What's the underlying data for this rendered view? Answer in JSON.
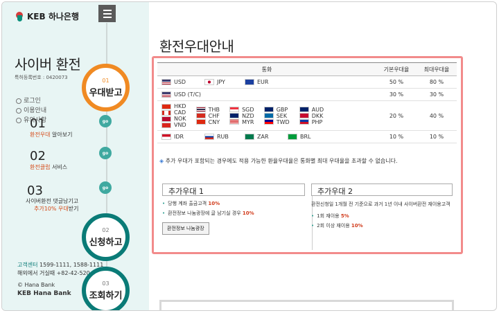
{
  "sidebar": {
    "logo": "KEB 하나은행",
    "title": "사이버 환전",
    "reg_no": "특허등록번호 : 0420073",
    "links": [
      "로그인",
      "이용안내",
      "유의사항"
    ],
    "step1": {
      "num": "01",
      "label": "우대받고"
    },
    "sub1": {
      "n": "01",
      "hl": "환전우대",
      "rest": " 알아보기"
    },
    "sub2": {
      "n": "02",
      "hl": "환전클럽",
      "rest": " 서비스"
    },
    "sub3": {
      "n": "03",
      "line1": "사이버환전 댓글남기고",
      "hl": "추가10% 우대",
      "rest": "받기"
    },
    "go": "go",
    "step2": {
      "num": "02",
      "label": "신청하고"
    },
    "step3": {
      "num": "03",
      "label": "조회하기"
    },
    "contact": {
      "label": "고객센터",
      "phones": " 1599-1111, 1588-1111",
      "overseas": "해외에서 거실때 +82-42-520"
    },
    "bank1": "© Hana Bank",
    "bank2": "KEB Hana Bank"
  },
  "main": {
    "title": "환전우대안내",
    "table": {
      "headers": [
        "통화",
        "기본우대율",
        "최대우대율"
      ],
      "rows": [
        {
          "items": [
            [
              "USD",
              "us"
            ],
            [
              "JPY",
              "jp"
            ],
            [
              "EUR",
              "eu"
            ]
          ],
          "basic": "50 %",
          "max": "80 %"
        },
        {
          "items": [
            [
              "USD (T/C)",
              "us"
            ]
          ],
          "basic": "30 %",
          "max": "30 %"
        },
        {
          "items": [
            [
              "HKD",
              "hk"
            ],
            [
              "CAD",
              "ca"
            ],
            [
              "NOK",
              "no"
            ],
            [
              "VND",
              "vn"
            ],
            [
              "THB",
              "th"
            ],
            [
              "CHF",
              "ch"
            ],
            [
              "CNY",
              "cn"
            ],
            [
              "SGD",
              "sg"
            ],
            [
              "NZD",
              "nz"
            ],
            [
              "MYR",
              "my"
            ],
            [
              "GBP",
              "gb"
            ],
            [
              "SEK",
              "se"
            ],
            [
              "TWD",
              "tw"
            ],
            [
              "AUD",
              "au"
            ],
            [
              "DKK",
              "dk"
            ],
            [
              "PHP",
              "ph"
            ]
          ],
          "basic": "20 %",
          "max": "40 %"
        },
        {
          "items": [
            [
              "IDR",
              "id"
            ],
            [
              "RUB",
              "ru"
            ],
            [
              "ZAR",
              "za"
            ],
            [
              "BRL",
              "br"
            ]
          ],
          "basic": "10 %",
          "max": "10 %"
        }
      ]
    },
    "note": "추가 우대가 포함되는 경우에도 적용 가능한 환율우대율은 통화별 최대 우대율을 초과할 수 없습니다.",
    "extra1": {
      "title": "추가우대 1",
      "item1": "당행 계좌 출금고객 ",
      "item1_hl": "10%",
      "item2": "환전정보 나눔광장에 글 남기실 경우 ",
      "item2_hl": "10%",
      "button": "환전정보 나눔광장"
    },
    "extra2": {
      "title": "추가우대 2",
      "desc": "환전신청일 1개월 전 기준으로 과거 1년 이내 사이버환전 재이용고객",
      "item1": "1회 재이용 ",
      "item1_hl": "5%",
      "item2": "2회 이상 재이용 ",
      "item2_hl": "10%"
    }
  },
  "colors": {
    "accent_orange": "#f08a23",
    "accent_teal": "#0a7b77",
    "panel_border": "#f28b8b",
    "highlight_red": "#d13a1a"
  }
}
